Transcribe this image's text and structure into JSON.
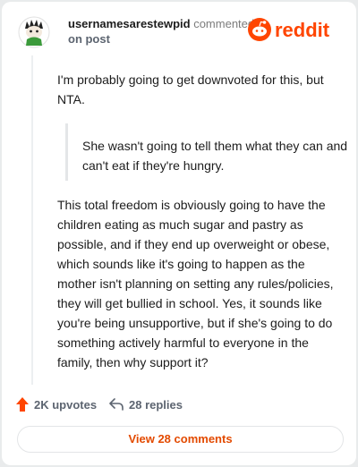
{
  "comment": {
    "username": "usernamesarestewpid",
    "action_text": "commented",
    "on_text": "on post",
    "intro": "I'm probably going to get downvoted for this, but NTA.",
    "quote": "She wasn't going to tell them what they can and can't eat if they're hungry.",
    "body": "This total freedom is obviously going to have the children eating as much sugar and pastry as possible, and if they end up overweight or obese, which sounds like it's going to happen as the mother isn't planning on setting any rules/policies, they will get bullied in school. Yes, it sounds like you're being unsupportive, but if she's going to do something actively harmful to everyone in the family, then why support it?"
  },
  "brand": {
    "name": "reddit",
    "color": "#ff4500"
  },
  "actions": {
    "upvotes": "2K upvotes",
    "replies": "28 replies"
  },
  "view_comments": "View 28 comments",
  "colors": {
    "accent": "#e34a00",
    "upvote": "#ff4500",
    "muted": "#5c6470"
  },
  "icons": [
    "avatar",
    "reddit-logo-icon",
    "upvote-arrow-icon",
    "reply-icon"
  ]
}
